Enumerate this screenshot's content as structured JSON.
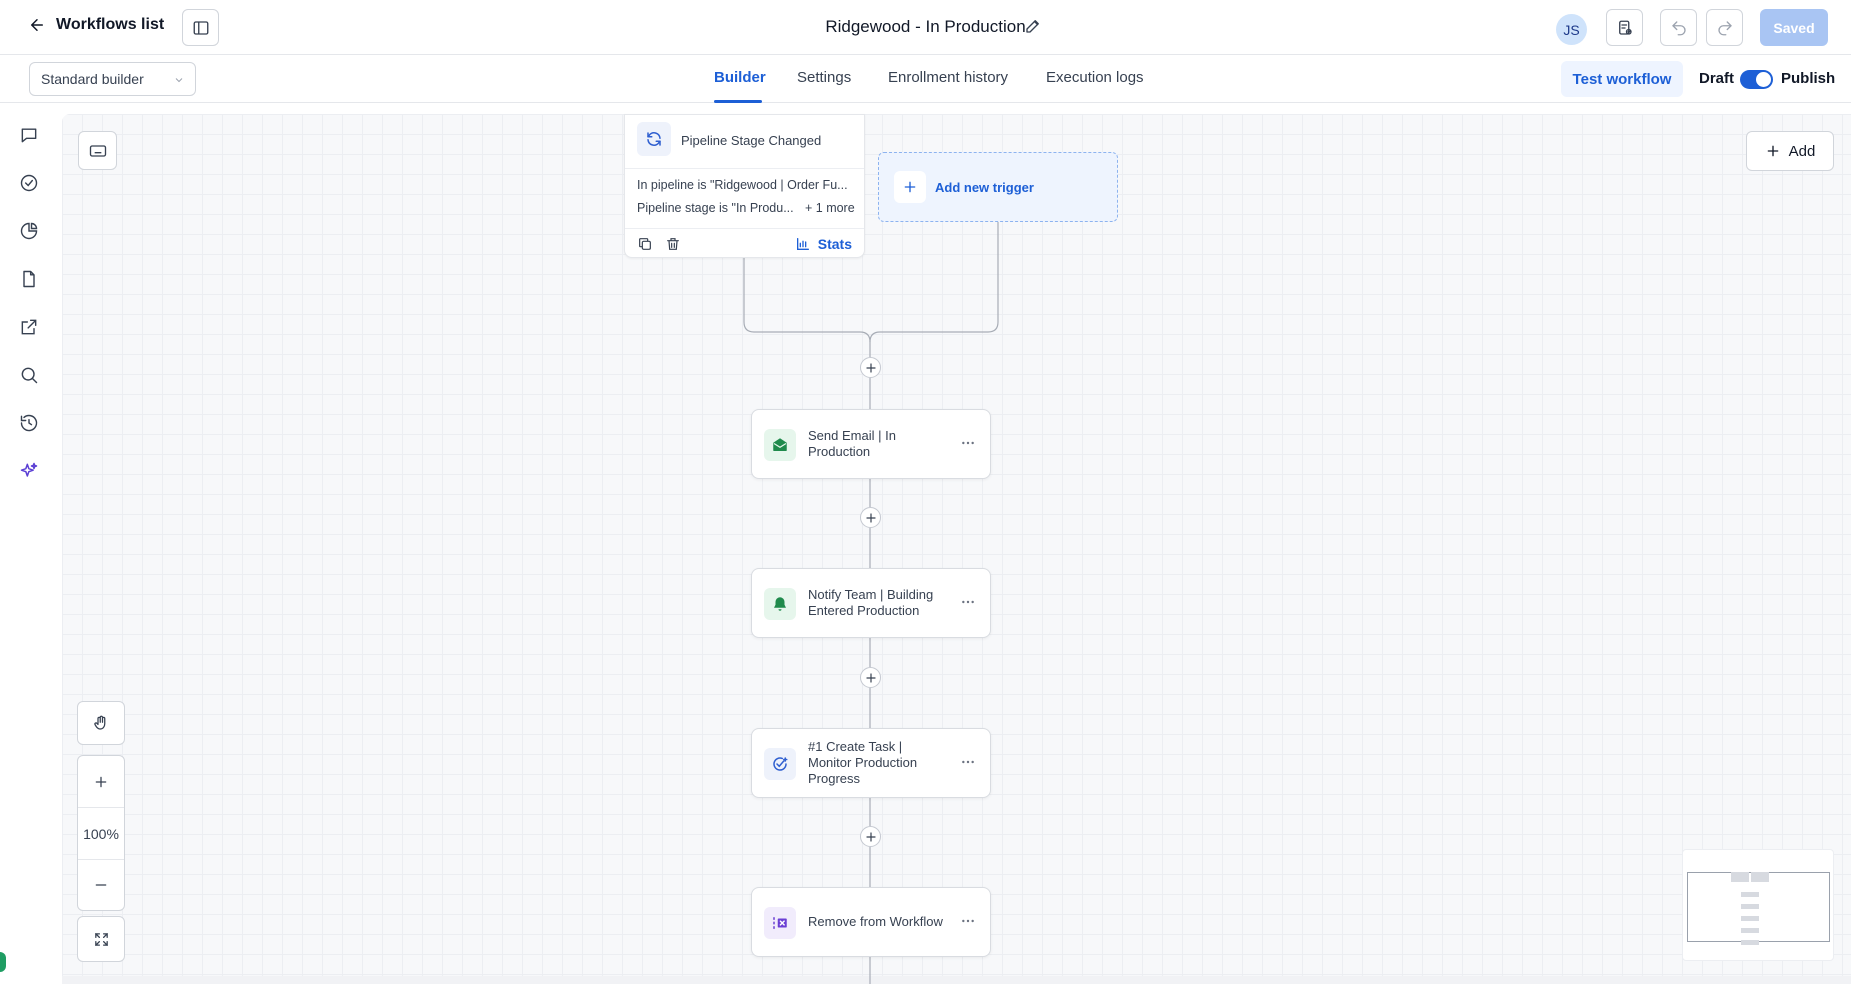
{
  "header": {
    "back_label": "Workflows list",
    "workflow_title": "Ridgewood - In Production",
    "avatar_initials": "JS",
    "saved_label": "Saved"
  },
  "subbar": {
    "builder_mode": "Standard builder",
    "tabs": [
      {
        "label": "Builder",
        "active": true
      },
      {
        "label": "Settings",
        "active": false
      },
      {
        "label": "Enrollment history",
        "active": false
      },
      {
        "label": "Execution logs",
        "active": false
      }
    ],
    "test_workflow_label": "Test workflow",
    "draft_label": "Draft",
    "publish_label": "Publish",
    "publish_toggle_on": true
  },
  "sidebar": {
    "icons": [
      "chat-icon",
      "check-circle-icon",
      "pie-chart-icon",
      "document-icon",
      "external-link-icon",
      "search-icon",
      "history-icon",
      "sparkles-icon"
    ]
  },
  "canvas": {
    "add_label": "Add",
    "zoom_level": "100%",
    "trigger": {
      "title": "Pipeline Stage Changed",
      "condition_1": "In pipeline is \"Ridgewood | Order Fu...",
      "condition_2": "Pipeline stage is \"In Produ...",
      "more_label": "+ 1 more",
      "stats_label": "Stats"
    },
    "add_trigger_label": "Add new trigger",
    "actions": [
      {
        "label": "Send Email | In Production",
        "icon": "envelope-icon",
        "color": "#1f8a4c",
        "bg": "#e6f6ec"
      },
      {
        "label": "Notify Team | Building Entered Production",
        "icon": "bell-icon",
        "color": "#1f8a4c",
        "bg": "#e6f6ec"
      },
      {
        "label": "#1 Create Task | Monitor Production Progress",
        "icon": "task-check-icon",
        "color": "#2f5fd0",
        "bg": "#eef2fb"
      },
      {
        "label": "Remove from Workflow",
        "icon": "remove-list-icon",
        "color": "#6b3fd4",
        "bg": "#f1ecfc"
      }
    ]
  },
  "colors": {
    "accent": "#1d5fd6",
    "saved_button": "#a9c5f3",
    "canvas_bg": "#f7f8fa"
  }
}
